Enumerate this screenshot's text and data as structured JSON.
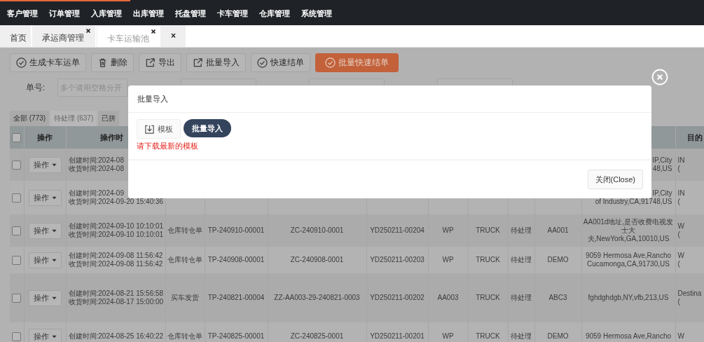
{
  "loading_bar": {
    "level": 0.185
  },
  "nav": {
    "items": [
      "客户管理",
      "订单管理",
      "入库管理",
      "出库管理",
      "托盘管理",
      "卡车管理",
      "仓库管理",
      "系统管理"
    ]
  },
  "page_tabs": [
    {
      "label": "首页",
      "closable": false,
      "selected": false
    },
    {
      "label": "承运商管理",
      "closable": true,
      "selected": false
    },
    {
      "label": "卡车运输池",
      "closable": true,
      "selected": true
    },
    {
      "label": "×",
      "closable": false,
      "selected": false
    }
  ],
  "toolbar": [
    {
      "label": "生成卡车运单",
      "kind": "confirm",
      "primary": false
    },
    {
      "label": "删除",
      "kind": "delete",
      "primary": false
    },
    {
      "label": "导出",
      "kind": "export",
      "primary": false
    },
    {
      "label": "批量导入",
      "kind": "export",
      "primary": false
    },
    {
      "label": "快速结单",
      "kind": "confirm",
      "primary": false
    },
    {
      "label": "批量快速结单",
      "kind": "confirm",
      "primary": true
    }
  ],
  "filter": {
    "label": "单号:",
    "placeholder": "多个请用空格分开"
  },
  "status_tabs": [
    {
      "label": "全部 (773)",
      "selected": false
    },
    {
      "label": "待处理 (637)",
      "selected": true
    },
    {
      "label": "已拼",
      "selected": false
    }
  ],
  "table": {
    "columns": [
      "操作",
      "操作时",
      "目的"
    ],
    "header_checked": false,
    "rows": [
      {
        "kind": "behind-dialog",
        "checked": false,
        "action": "操作",
        "times": [
          "创建时间:2024-08",
          "收货时间:2024-08"
        ],
        "address": [
          "IP,City",
          "48,US"
        ],
        "destination": [
          "IN",
          "("
        ]
      },
      {
        "kind": "behind-dialog",
        "checked": false,
        "action": "操作",
        "times": [
          "创建时间:2024-09",
          "收货时间:2024-09-20 15:40:36"
        ],
        "address": [
          "IP,City",
          "of Industry,CA,91748,US"
        ],
        "destination": [
          "IN",
          "("
        ]
      },
      {
        "kind": "full",
        "checked": false,
        "action": "操作",
        "times": [
          "创建时间:2024-09-10 10:10:01",
          "收货时间:2024-09-10 10:10:01"
        ],
        "cells": [
          "仓库转仓单",
          "TP-240910-00001",
          "ZC-240910-0001",
          "YD250211-00204",
          "WP",
          "TRUCK",
          "待处理",
          "AA001"
        ],
        "address": [
          "AA001d地址,是否收费电视发",
          "士大",
          "夫,NewYork,GA,10010,US"
        ],
        "destination": [
          "W",
          "("
        ]
      },
      {
        "kind": "full",
        "checked": false,
        "action": "操作",
        "times": [
          "创建时间:2024-09-08 11:56:42",
          "收货时间:2024-09-08 11:56:42"
        ],
        "cells": [
          "仓库转仓单",
          "TP-240908-00001",
          "ZC-240908-0001",
          "YD250211-00203",
          "WP",
          "TRUCK",
          "待处理",
          "DEMO"
        ],
        "address": [
          "9059 Hermosa Ave,Rancho",
          "Cucamonga,CA,91730,US"
        ],
        "destination": [
          "W",
          "("
        ]
      },
      {
        "kind": "full",
        "checked": false,
        "action": "操作",
        "times": [
          "创建时间:2024-08-21 15:56:58",
          "收货时间:2024-08-17 15:00:00"
        ],
        "cells": [
          "买车发货",
          "TP-240821-00004",
          "ZZ-AA003-29-240821-0003",
          "YD250211-00202",
          "AA003",
          "TRUCK",
          "待处理",
          "ABC3"
        ],
        "address": [
          "fghdghdgb,NY,vfb,213,US"
        ],
        "destination": [
          "Destina",
          "("
        ]
      },
      {
        "kind": "full",
        "checked": false,
        "action": "操作",
        "times": [
          "创建时间:2024-08-25 16:40:22"
        ],
        "cells": [
          "仓库转仓单",
          "TP-240825-00001",
          "ZC-240825-0001",
          "YD250211-00201",
          "WP",
          "TRUCK",
          "待处理",
          "DEMO"
        ],
        "address": [
          "9059 Hermosa Ave,Rancho"
        ],
        "destination": [
          "W"
        ]
      }
    ]
  },
  "dialog": {
    "title": "批量导入",
    "template_button": "模板",
    "import_button": "批量导入",
    "hint": "请下载最新的模板",
    "close_button": "关闭(Close)"
  }
}
